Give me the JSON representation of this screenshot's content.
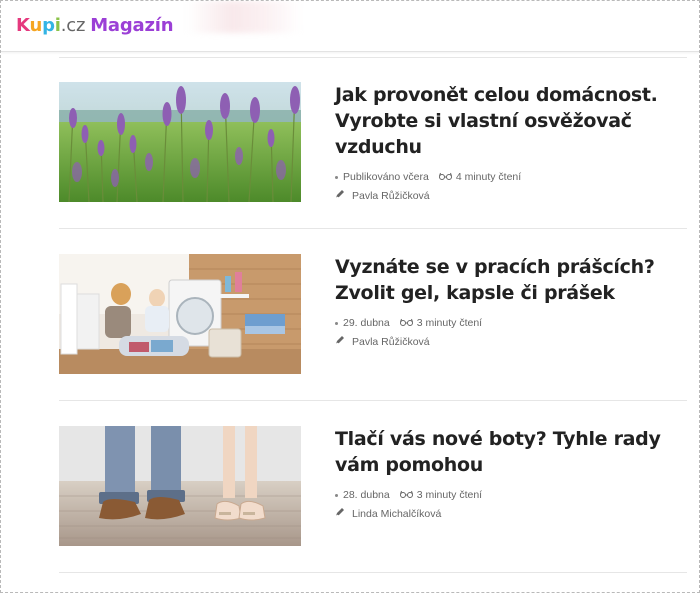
{
  "brand": {
    "logo_letters": [
      "K",
      "u",
      "p",
      "i"
    ],
    "logo_colors": [
      "#e5397e",
      "#f5a623",
      "#34b4e4",
      "#8bc34a"
    ],
    "logo_cz": ".cz",
    "logo_magazine": "Magazín",
    "cz_color": "#666666",
    "magazine_color": "#9b3fd6"
  },
  "articles": [
    {
      "title": "Jak provonět celou domácnost. Vyrobte si vlastní osvěžovač vzduchu",
      "date": "Publikováno včera",
      "read_time": "4 minuty čtení",
      "author": "Pavla Růžičková",
      "image": "lavender-field-photo"
    },
    {
      "title": "Vyznáte se v pracích prášcích? Zvolit gel, kapsle či prášek",
      "date": "29. dubna",
      "read_time": "3 minuty čtení",
      "author": "Pavla Růžičková",
      "image": "laundry-room-photo"
    },
    {
      "title": "Tlačí vás nové boty? Tyhle rady vám pomohou",
      "date": "28. dubna",
      "read_time": "3 minuty čtení",
      "author": "Linda Michalčíková",
      "image": "shoes-on-wooden-floor-photo"
    }
  ],
  "icons": {
    "read_time": "glasses-icon",
    "author": "pen-icon"
  }
}
